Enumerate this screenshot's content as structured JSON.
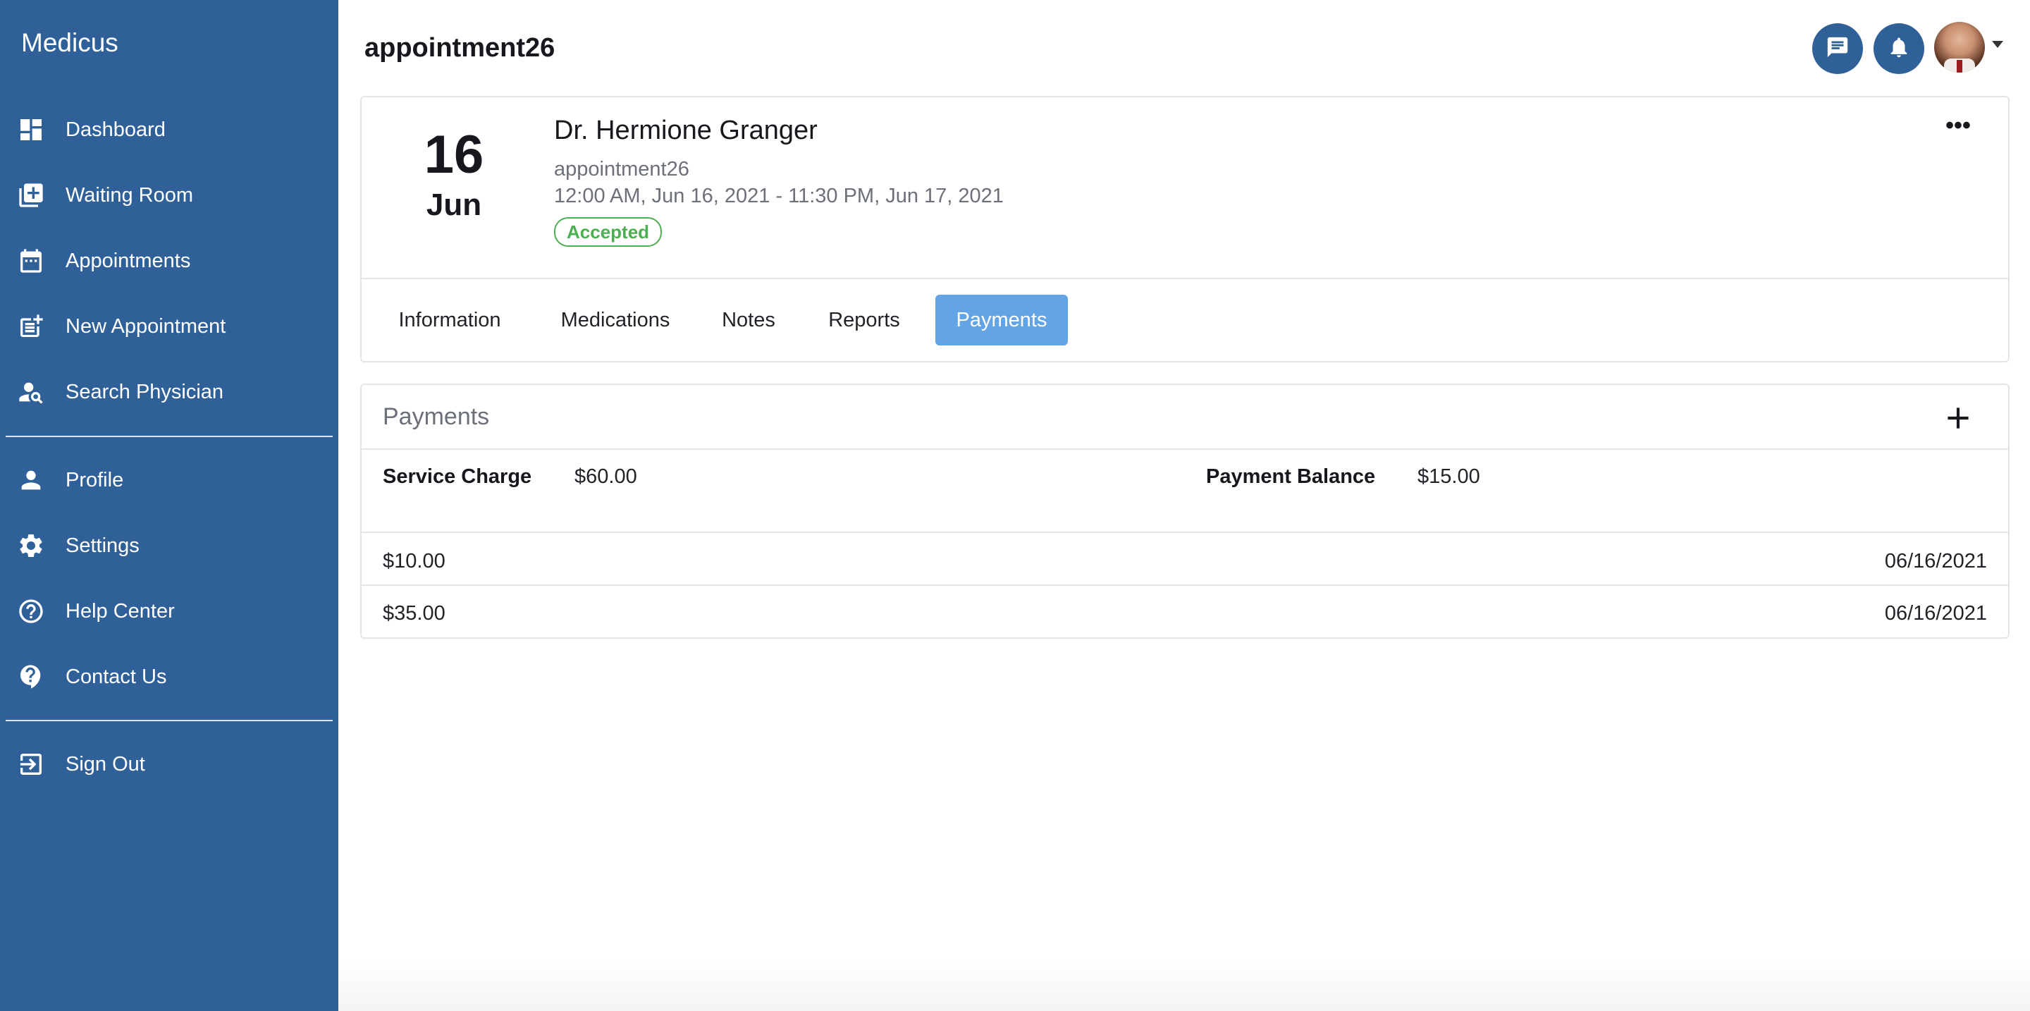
{
  "app": {
    "brand": "Medicus"
  },
  "sidebar": {
    "items": [
      {
        "label": "Dashboard",
        "icon": "dashboard-icon"
      },
      {
        "label": "Waiting Room",
        "icon": "add-box-icon"
      },
      {
        "label": "Appointments",
        "icon": "calendar-icon"
      },
      {
        "label": "New Appointment",
        "icon": "post-add-icon"
      },
      {
        "label": "Search Physician",
        "icon": "person-search-icon"
      },
      {
        "label": "Profile",
        "icon": "person-icon"
      },
      {
        "label": "Settings",
        "icon": "gear-icon"
      },
      {
        "label": "Help Center",
        "icon": "help-circle-icon"
      },
      {
        "label": "Contact Us",
        "icon": "help-bubble-icon"
      },
      {
        "label": "Sign Out",
        "icon": "logout-icon"
      }
    ]
  },
  "header": {
    "title": "appointment26",
    "icons": [
      "chat-icon",
      "bell-icon",
      "avatar"
    ]
  },
  "appointment": {
    "day": "16",
    "month": "Jun",
    "doctor": "Dr. Hermione Granger",
    "name": "appointment26",
    "time_range": "12:00 AM, Jun 16, 2021 - 11:30 PM, Jun 17, 2021",
    "status": "Accepted",
    "tabs": [
      {
        "label": "Information"
      },
      {
        "label": "Medications"
      },
      {
        "label": "Notes"
      },
      {
        "label": "Reports"
      },
      {
        "label": "Payments"
      }
    ],
    "active_tab": "Payments"
  },
  "payments": {
    "title": "Payments",
    "service_charge_label": "Service Charge",
    "service_charge_value": "$60.00",
    "balance_label": "Payment Balance",
    "balance_value": "$15.00",
    "rows": [
      {
        "amount": "$10.00",
        "date": "06/16/2021"
      },
      {
        "amount": "$35.00",
        "date": "06/16/2021"
      }
    ]
  },
  "colors": {
    "sidebar": "#2f6098",
    "accent_tab": "#63a4e4",
    "status_green": "#4caf50"
  }
}
